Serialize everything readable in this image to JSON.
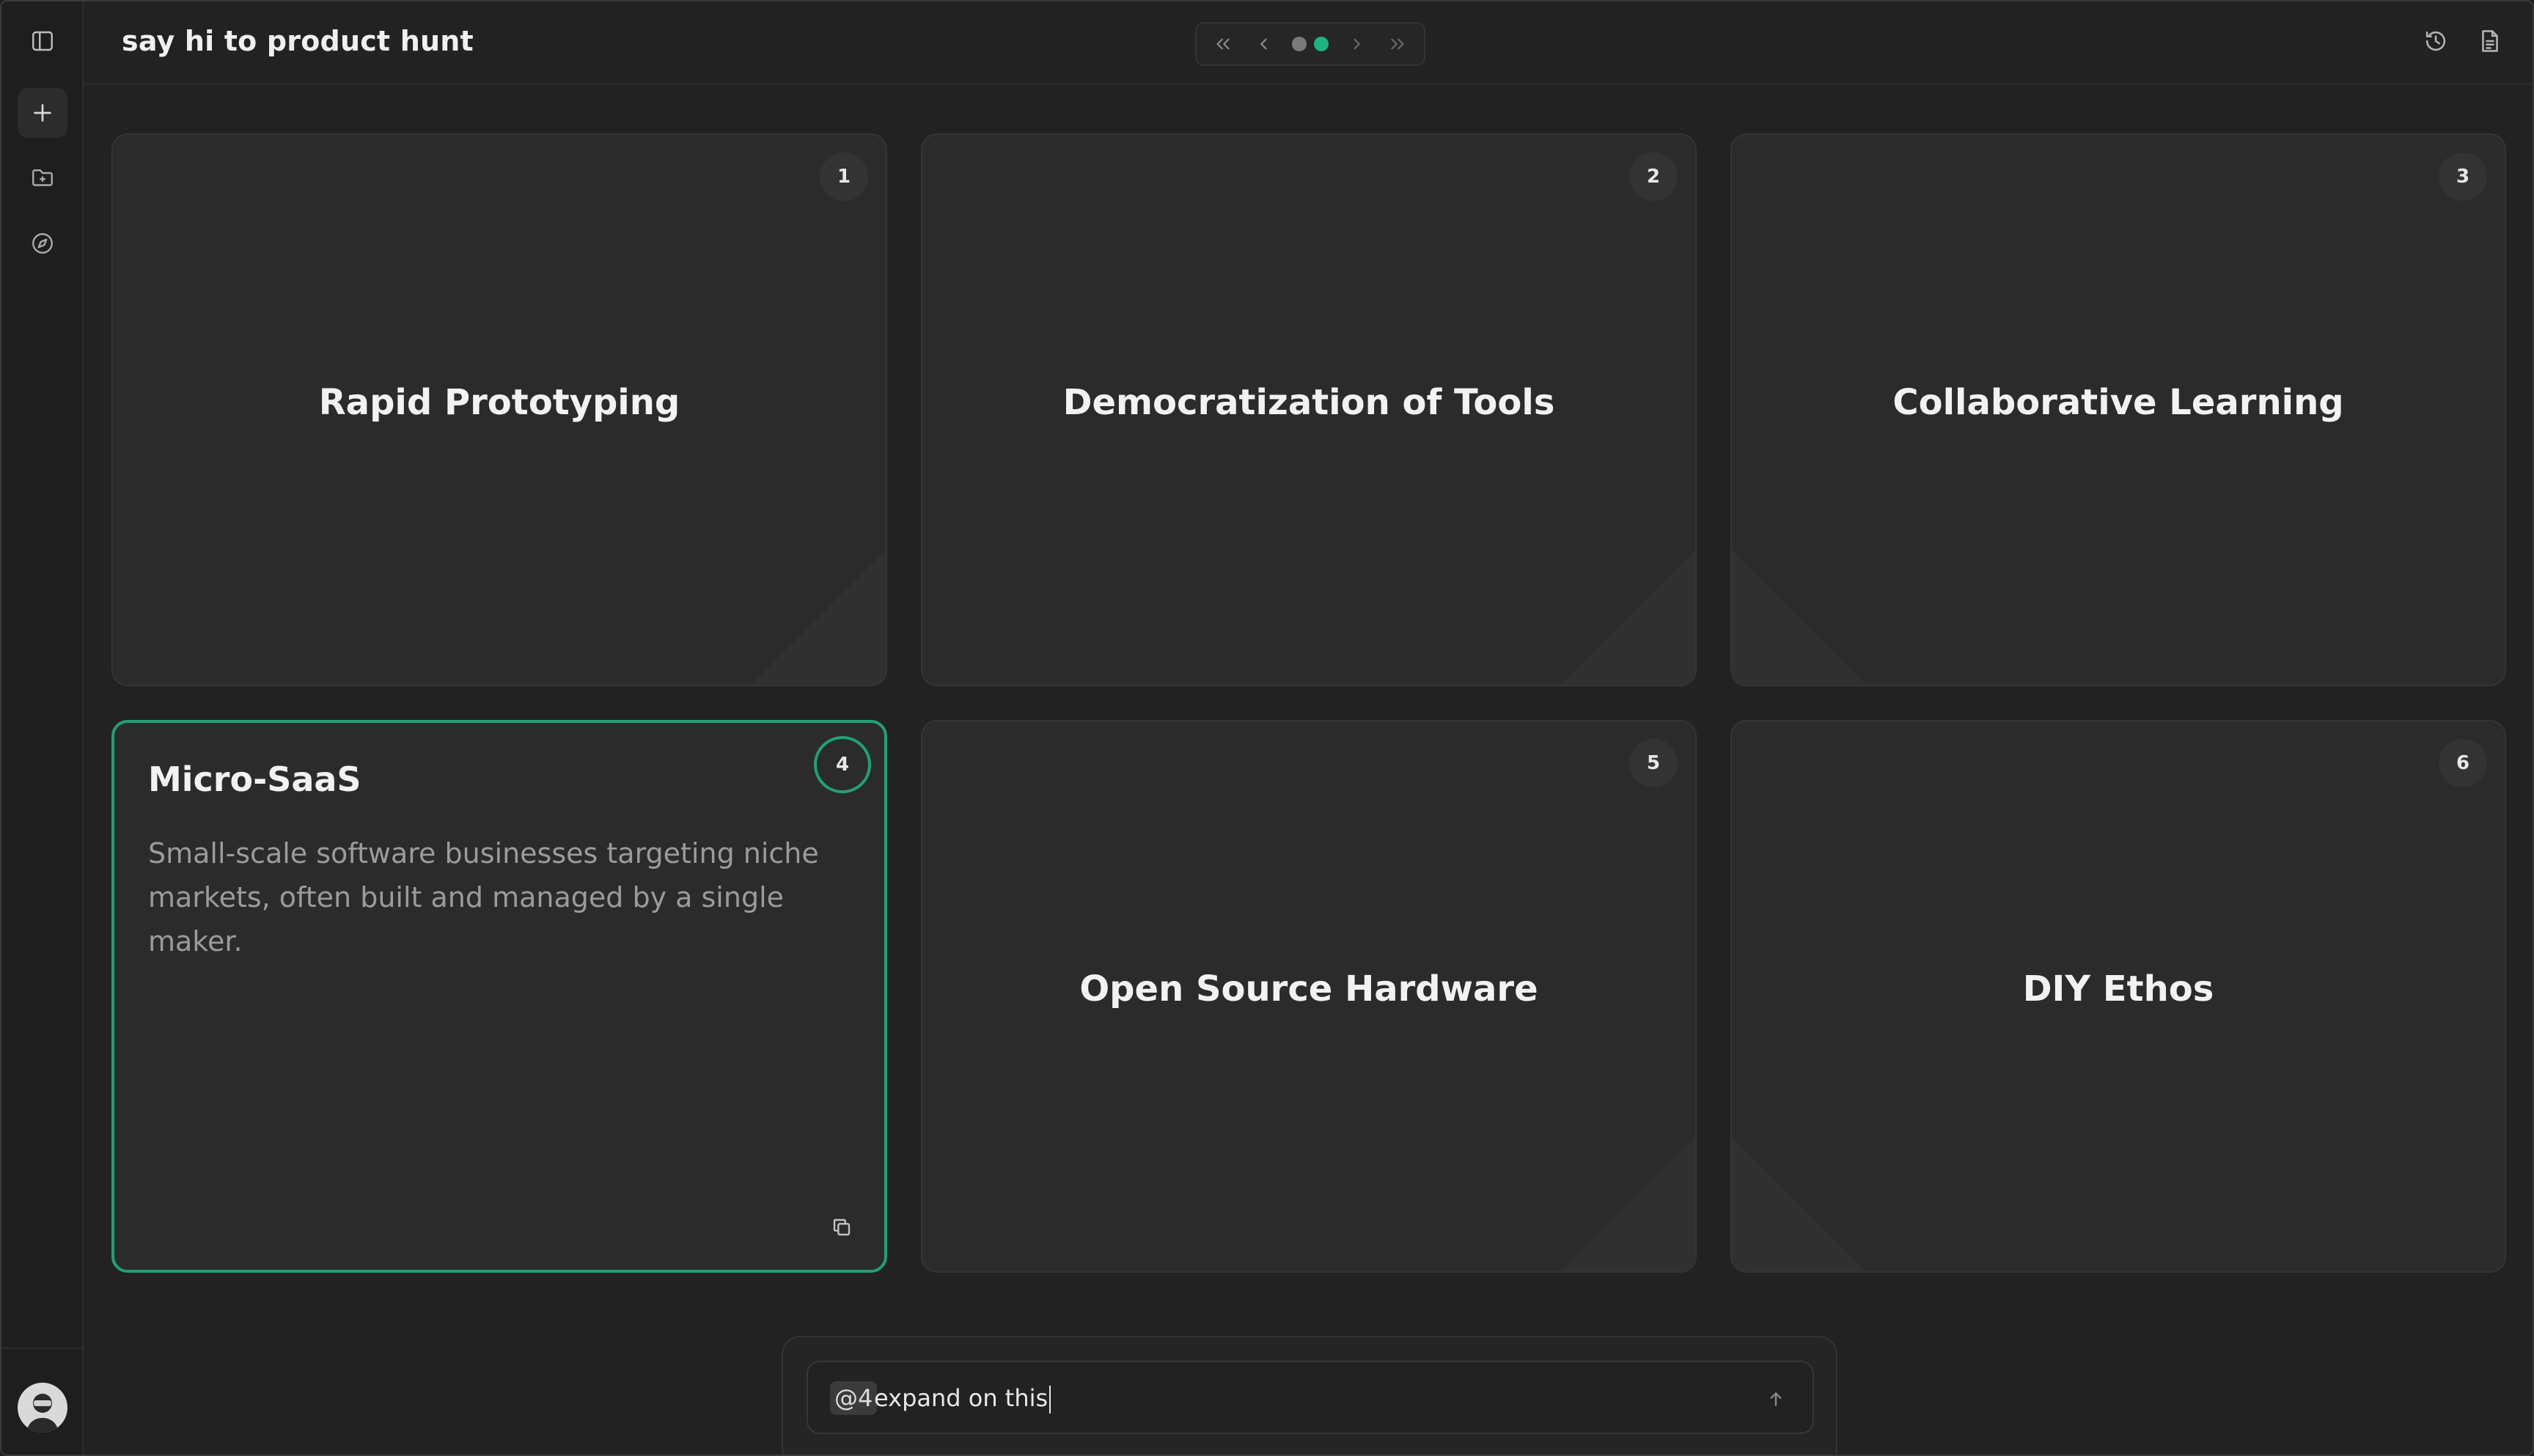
{
  "header": {
    "title": "say hi to product hunt",
    "pager": {
      "pages": 2,
      "current": 2
    }
  },
  "rail": {
    "items": [
      {
        "name": "toggle-sidebar",
        "icon": "sidebar-icon"
      },
      {
        "name": "new",
        "icon": "plus-icon"
      },
      {
        "name": "folders",
        "icon": "folder-add-icon"
      },
      {
        "name": "explore",
        "icon": "compass-icon"
      }
    ]
  },
  "cards": [
    {
      "number": "1",
      "title": "Rapid Prototyping"
    },
    {
      "number": "2",
      "title": "Democratization of Tools"
    },
    {
      "number": "3",
      "title": "Collaborative Learning"
    },
    {
      "number": "4",
      "title": "Micro-SaaS",
      "description": "Small-scale software businesses targeting niche markets, often built and managed by a single maker.",
      "selected": true
    },
    {
      "number": "5",
      "title": "Open Source Hardware"
    },
    {
      "number": "6",
      "title": "DIY Ethos"
    }
  ],
  "composer": {
    "mention": "@4",
    "text": " expand on this"
  },
  "colors": {
    "accent": "#1fa273",
    "background": "#222222",
    "card": "#2b2b2b"
  }
}
